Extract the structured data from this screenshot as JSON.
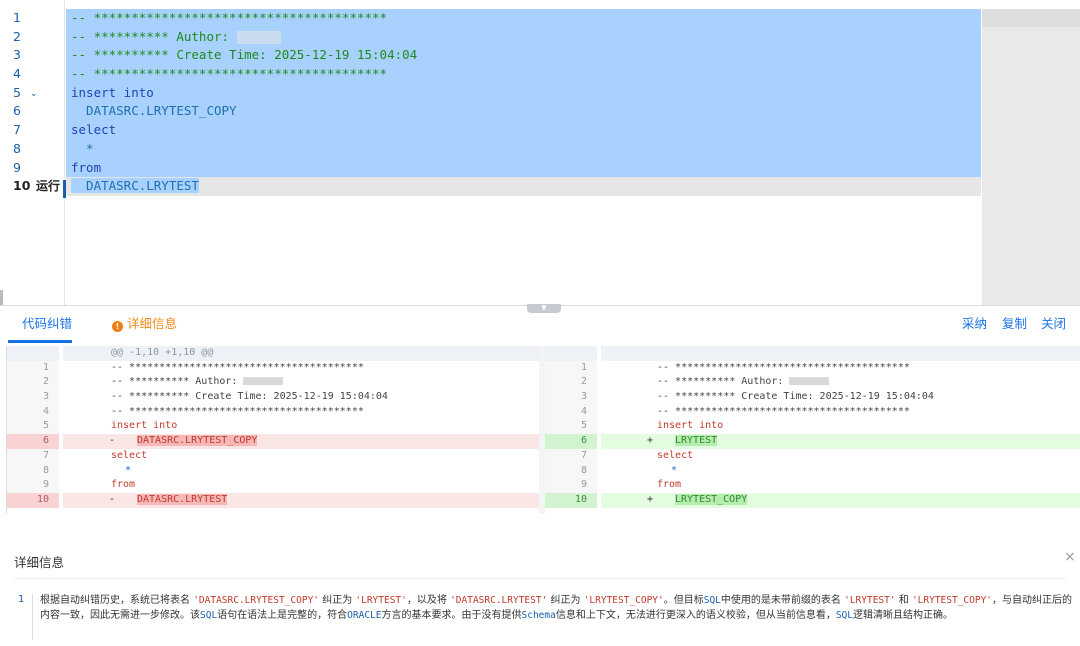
{
  "editor": {
    "line_numbers": [
      "1",
      "2",
      "3",
      "4",
      "5",
      "6",
      "7",
      "8",
      "9",
      "10"
    ],
    "run_label": "运行",
    "lines": [
      "-- ***************************************",
      "-- ********** Author:",
      "-- ********** Create Time: 2025-12-19 15:04:04",
      "-- ***************************************",
      "insert into",
      "  DATASRC.LRYTEST_COPY",
      "select",
      "  *",
      "from",
      "  DATASRC.LRYTEST"
    ]
  },
  "tabs": {
    "fix": "代码纠错",
    "detail": "详细信息",
    "warn_icon": "!"
  },
  "actions": {
    "adopt": "采纳",
    "copy": "复制",
    "close": "关闭"
  },
  "diff": {
    "hunk_header": "@@ -1,10 +1,10 @@",
    "left": {
      "lines": [
        {
          "n": "1",
          "text": "-- ***************************************"
        },
        {
          "n": "2",
          "text": "-- ********** Author:"
        },
        {
          "n": "3",
          "text": "-- ********** Create Time: 2025-12-19 15:04:04"
        },
        {
          "n": "4",
          "text": "-- ***************************************"
        },
        {
          "n": "5",
          "text": "insert into"
        },
        {
          "n": "6",
          "text": "DATASRC.LRYTEST_COPY",
          "sign": "-"
        },
        {
          "n": "7",
          "text": "select"
        },
        {
          "n": "8",
          "text": "*"
        },
        {
          "n": "9",
          "text": "from"
        },
        {
          "n": "10",
          "text": "DATASRC.LRYTEST",
          "sign": "-"
        }
      ]
    },
    "right": {
      "lines": [
        {
          "n": "1",
          "text": "-- ***************************************"
        },
        {
          "n": "2",
          "text": "-- ********** Author:"
        },
        {
          "n": "3",
          "text": "-- ********** Create Time: 2025-12-19 15:04:04"
        },
        {
          "n": "4",
          "text": "-- ***************************************"
        },
        {
          "n": "5",
          "text": "insert into"
        },
        {
          "n": "6",
          "text": "LRYTEST",
          "sign": "+"
        },
        {
          "n": "7",
          "text": "select"
        },
        {
          "n": "8",
          "text": "*"
        },
        {
          "n": "9",
          "text": "from"
        },
        {
          "n": "10",
          "text": "LRYTEST_COPY",
          "sign": "+"
        }
      ]
    }
  },
  "detail_panel": {
    "title": "详细信息",
    "close_icon": "×",
    "item_number": "1",
    "paragraph": {
      "p1": "根据自动纠错历史，系统已将表名 ",
      "q1": "'DATASRC.LRYTEST_COPY'",
      "p2": " 纠正为 ",
      "q2": "'LRYTEST'",
      "p3": "，以及将 ",
      "q3": "'DATASRC.LRYTEST'",
      "p4": " 纠正为 ",
      "q4": "'LRYTEST_COPY'",
      "p5": "。但目标",
      "sql1": "SQL",
      "p6": "中使用的是未带前缀的表名 ",
      "q5": "'LRYTEST'",
      "p7": " 和 ",
      "q6": "'LRYTEST_COPY'",
      "p8": "，与自动纠正后的内容一致，因此无需进一步修改。该",
      "sql2": "SQL",
      "p9": "语句在语法上是完整的，符合",
      "oracle": "ORACLE",
      "p10": "方言的基本要求。由于没有提供",
      "schema": "Schema",
      "p11": "信息和上下文，无法进行更深入的语义校验，但从当前信息看，",
      "sql3": "SQL",
      "p12": "逻辑清晰且结构正确。"
    }
  }
}
